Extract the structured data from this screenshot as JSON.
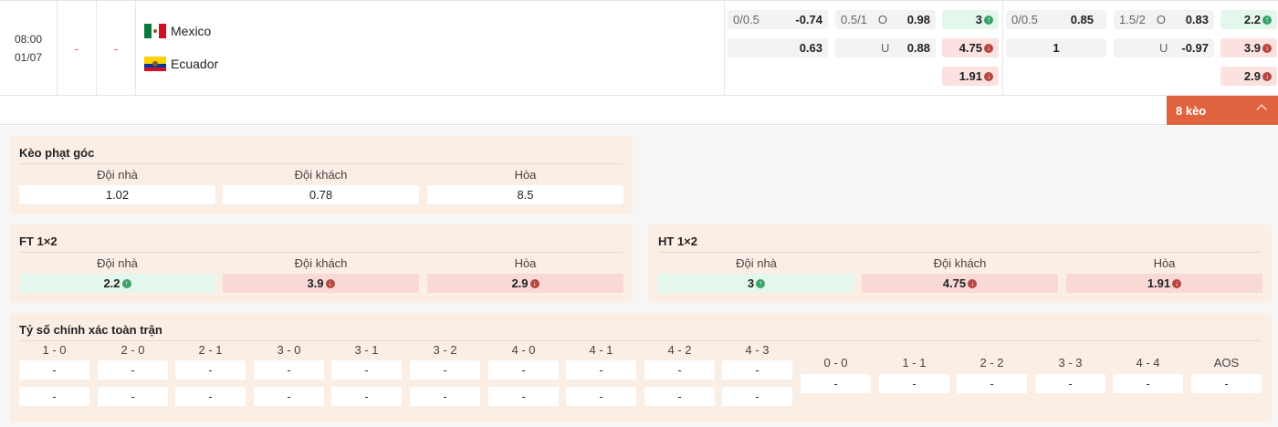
{
  "match": {
    "time": "08:00",
    "date": "01/07",
    "score_full": "-",
    "score_half": "-",
    "home_team": "Mexico",
    "away_team": "Ecuador",
    "home_flag": "mexico-flag",
    "away_flag": "ecuador-flag"
  },
  "ft_odds": {
    "hdp_line": "0/0.5",
    "hdp_home": "-0.74",
    "hdp_away": "0.63",
    "ou_line": "0.5/1",
    "ou_over_label": "O",
    "ou_over": "0.98",
    "ou_under_label": "U",
    "ou_under": "0.88",
    "x12_home": "3",
    "x12_away": "4.75",
    "x12_draw": "1.91"
  },
  "ht_odds": {
    "hdp_line": "0/0.5",
    "hdp_home": "0.85",
    "hdp_away": "1",
    "ou_line": "1.5/2",
    "ou_over_label": "O",
    "ou_over": "0.83",
    "ou_under_label": "U",
    "ou_under": "-0.97",
    "x12_home": "2.2",
    "x12_away": "3.9",
    "x12_draw": "2.9"
  },
  "toggle": {
    "label": "8 kèo"
  },
  "corner": {
    "title": "Kèo phạt góc",
    "headers": [
      "Đội nhà",
      "Đội khách",
      "Hòa"
    ],
    "values": [
      "1.02",
      "0.78",
      "8.5"
    ]
  },
  "ft1x2": {
    "title": "FT 1×2",
    "headers": [
      "Đội nhà",
      "Đội khách",
      "Hòa"
    ],
    "values": [
      "2.2",
      "3.9",
      "2.9"
    ]
  },
  "ht1x2": {
    "title": "HT 1×2",
    "headers": [
      "Đội nhà",
      "Đội khách",
      "Hòa"
    ],
    "values": [
      "3",
      "4.75",
      "1.91"
    ]
  },
  "correct_score": {
    "title": "Tỷ số chính xác toàn trận",
    "home_cols": [
      "1 - 0",
      "2 - 0",
      "2 - 1",
      "3 - 0",
      "3 - 1",
      "3 - 2",
      "4 - 0",
      "4 - 1",
      "4 - 2",
      "4 - 3"
    ],
    "draw_cols": [
      "0 - 0",
      "1 - 1",
      "2 - 2",
      "3 - 3",
      "4 - 4",
      "AOS"
    ],
    "home_row": [
      "-",
      "-",
      "-",
      "-",
      "-",
      "-",
      "-",
      "-",
      "-",
      "-"
    ],
    "away_row": [
      "-",
      "-",
      "-",
      "-",
      "-",
      "-",
      "-",
      "-",
      "-",
      "-"
    ],
    "draw_row": [
      "-",
      "-",
      "-",
      "-",
      "-",
      "-"
    ]
  },
  "colors": {
    "accent": "#e0633f",
    "up": "#3aa36a",
    "down": "#b5473f",
    "panel": "#fbeee5"
  }
}
